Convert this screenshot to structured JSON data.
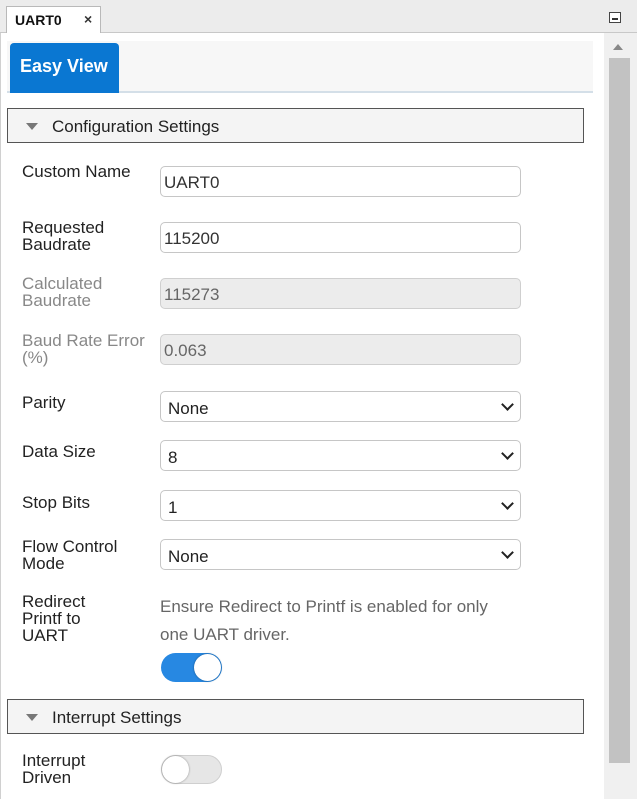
{
  "tab": {
    "title": "UART0",
    "close_glyph": "×"
  },
  "panel": {
    "view_tab": "Easy View"
  },
  "config_section": {
    "title": "Configuration Settings",
    "custom_name": {
      "label": "Custom Name",
      "value": "UART0"
    },
    "requested_baudrate": {
      "label": "Requested Baudrate",
      "value": "115200"
    },
    "calculated_baudrate": {
      "label": "Calculated Baudrate",
      "value": "115273"
    },
    "baud_rate_error": {
      "label": "Baud Rate Error (%)",
      "value": "0.063"
    },
    "parity": {
      "label": "Parity",
      "value": "None"
    },
    "data_size": {
      "label": "Data Size",
      "value": "8"
    },
    "stop_bits": {
      "label": "Stop Bits",
      "value": "1"
    },
    "flow_control": {
      "label": "Flow Control Mode",
      "value": "None"
    },
    "redirect_printf": {
      "label": "Redirect Printf to UART",
      "info": "Ensure Redirect to Printf is enabled for only one UART driver.",
      "enabled": true
    }
  },
  "interrupt_section": {
    "title": "Interrupt Settings",
    "interrupt_driven": {
      "label": "Interrupt Driven",
      "enabled": false
    }
  },
  "colors": {
    "accent": "#0a77d2",
    "toggle_on": "#2788e2"
  },
  "icons": [
    "close-icon",
    "minimize-icon",
    "caret-down-icon",
    "chevron-down-icon",
    "scroll-up-icon"
  ]
}
